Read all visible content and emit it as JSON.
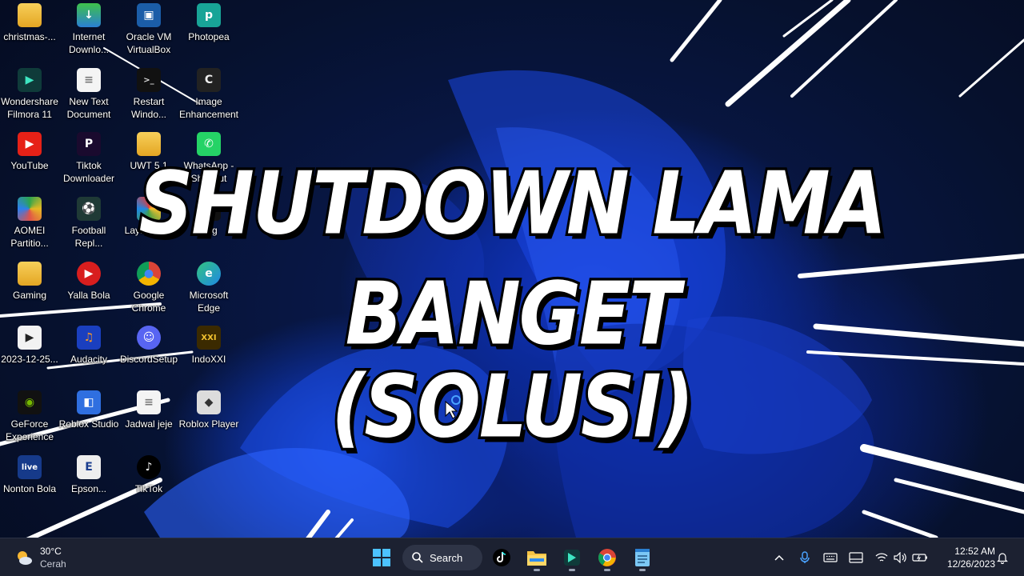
{
  "desktop": {
    "icons": [
      {
        "label": "christmas-...",
        "icon": "folder-icon"
      },
      {
        "label": "Wondershare Filmora 11",
        "icon": "filmora-icon"
      },
      {
        "label": "YouTube",
        "icon": "youtube-icon"
      },
      {
        "label": "AOMEI Partitio...",
        "icon": "aomei-icon"
      },
      {
        "label": "Gaming",
        "icon": "folder-icon"
      },
      {
        "label": "2023-12-25...",
        "icon": "video-file-icon"
      },
      {
        "label": "GeForce Experience",
        "icon": "nvidia-icon"
      },
      {
        "label": "Nonton Bola",
        "icon": "live-icon"
      },
      {
        "label": "Internet Downlo...",
        "icon": "idm-icon"
      },
      {
        "label": "New Text Document",
        "icon": "text-file-icon"
      },
      {
        "label": "Tiktok Downloader",
        "icon": "tiktok-downloader-icon"
      },
      {
        "label": "Football Repl...",
        "icon": "football-icon"
      },
      {
        "label": "Yalla Bola",
        "icon": "play-icon"
      },
      {
        "label": "Audacity",
        "icon": "audacity-icon"
      },
      {
        "label": "Roblox Studio",
        "icon": "roblox-studio-icon"
      },
      {
        "label": "Epson...",
        "icon": "epson-icon"
      },
      {
        "label": "Oracle VM VirtualBox",
        "icon": "virtualbox-icon"
      },
      {
        "label": "Restart Windo...",
        "icon": "terminal-icon"
      },
      {
        "label": "UWT 5.1",
        "icon": "folder-icon"
      },
      {
        "label": "Layar Kaca",
        "icon": "layar-kaca-icon"
      },
      {
        "label": "Google Chrome",
        "icon": "chrome-icon"
      },
      {
        "label": "DiscordSetup",
        "icon": "discord-icon"
      },
      {
        "label": "Jadwal jeje",
        "icon": "text-file-icon"
      },
      {
        "label": "TikTok",
        "icon": "tiktok-icon"
      },
      {
        "label": "Photopea",
        "icon": "photopea-icon"
      },
      {
        "label": "Image Enhancement",
        "icon": "image-enhancement-icon"
      },
      {
        "label": "WhatsApp - Shortcut",
        "icon": "whatsapp-icon"
      },
      {
        "label": "Png",
        "icon": "image-file-icon"
      },
      {
        "label": "Microsoft Edge",
        "icon": "edge-icon"
      },
      {
        "label": "IndoXXI",
        "icon": "indoxxi-icon"
      },
      {
        "label": "Roblox Player",
        "icon": "roblox-icon"
      }
    ]
  },
  "overlay": {
    "line1": "SHUTDOWN LAMA BANGET",
    "line2": "(SOLUSI)"
  },
  "taskbar": {
    "weather": {
      "temp": "30°C",
      "condition": "Cerah"
    },
    "search_label": "Search",
    "clock": {
      "time": "12:52 AM",
      "date": "12/26/2023"
    }
  },
  "colors": {
    "taskbar_bg": "#1c2131",
    "wallpaper_blue": "#1436c8",
    "accent": "#4aa3ff"
  }
}
